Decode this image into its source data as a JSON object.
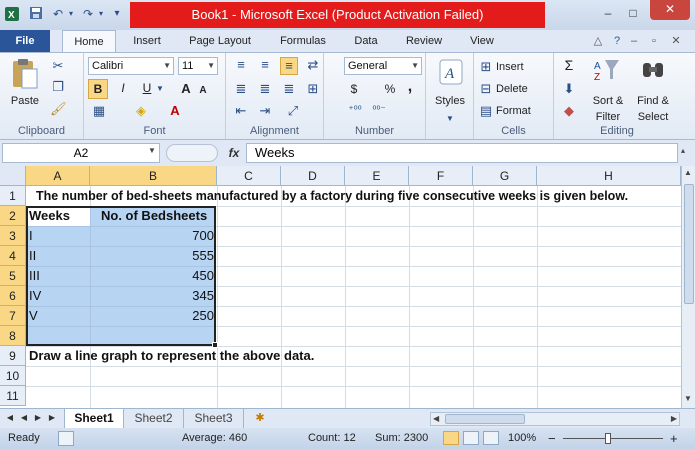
{
  "titlebar": {
    "title": "Book1 - Microsoft Excel (Product Activation Failed)",
    "controls": {
      "minimize": "–",
      "maximize": "□",
      "close": "✕"
    }
  },
  "tabs": [
    {
      "label": "File"
    },
    {
      "label": "Home"
    },
    {
      "label": "Insert"
    },
    {
      "label": "Page Layout"
    },
    {
      "label": "Formulas"
    },
    {
      "label": "Data"
    },
    {
      "label": "Review"
    },
    {
      "label": "View"
    }
  ],
  "ribbon": {
    "clipboard": {
      "group_label": "Clipboard",
      "paste_label": "Paste"
    },
    "font": {
      "group_label": "Font",
      "font_name": "Calibri",
      "font_size": "11",
      "bold": "B",
      "italic": "I",
      "underline": "U",
      "grow": "A",
      "shrink": "A"
    },
    "alignment": {
      "group_label": "Alignment"
    },
    "number": {
      "group_label": "Number",
      "format": "General",
      "currency": "$",
      "percent": "%",
      "comma": ","
    },
    "styles": {
      "group_label": "",
      "styles_label": "Styles"
    },
    "cells": {
      "group_label": "Cells",
      "insert_label": "Insert",
      "delete_label": "Delete",
      "format_label": "Format"
    },
    "editing": {
      "group_label": "Editing",
      "sort_label": "Sort &",
      "sort_label2": "Filter",
      "find_label": "Find &",
      "find_label2": "Select",
      "sum_icon": "Σ"
    }
  },
  "formula_bar": {
    "name_box": "A2",
    "fx": "fx",
    "value": "Weeks"
  },
  "grid": {
    "columns": [
      "A",
      "B",
      "C",
      "D",
      "E",
      "F",
      "G",
      "H"
    ],
    "rows": [
      "1",
      "2",
      "3",
      "4",
      "5",
      "6",
      "7",
      "8",
      "9",
      "10",
      "11"
    ],
    "cells": {
      "r1": "The number of bed-sheets manufactured by a factory during five consecutive weeks is given below.",
      "header_a": "Weeks",
      "header_b": "No. of Bedsheets",
      "data": [
        {
          "week": "I",
          "value": "700"
        },
        {
          "week": "II",
          "value": "555"
        },
        {
          "week": "III",
          "value": "450"
        },
        {
          "week": "IV",
          "value": "345"
        },
        {
          "week": "V",
          "value": "250"
        }
      ],
      "r9": "Draw a line graph to represent the above data."
    }
  },
  "sheets": [
    {
      "label": "Sheet1"
    },
    {
      "label": "Sheet2"
    },
    {
      "label": "Sheet3"
    }
  ],
  "status": {
    "mode": "Ready",
    "average": "Average: 460",
    "count": "Count: 12",
    "sum": "Sum: 2300",
    "zoom": "100%",
    "zoom_minus": "−",
    "zoom_plus": "+"
  }
}
